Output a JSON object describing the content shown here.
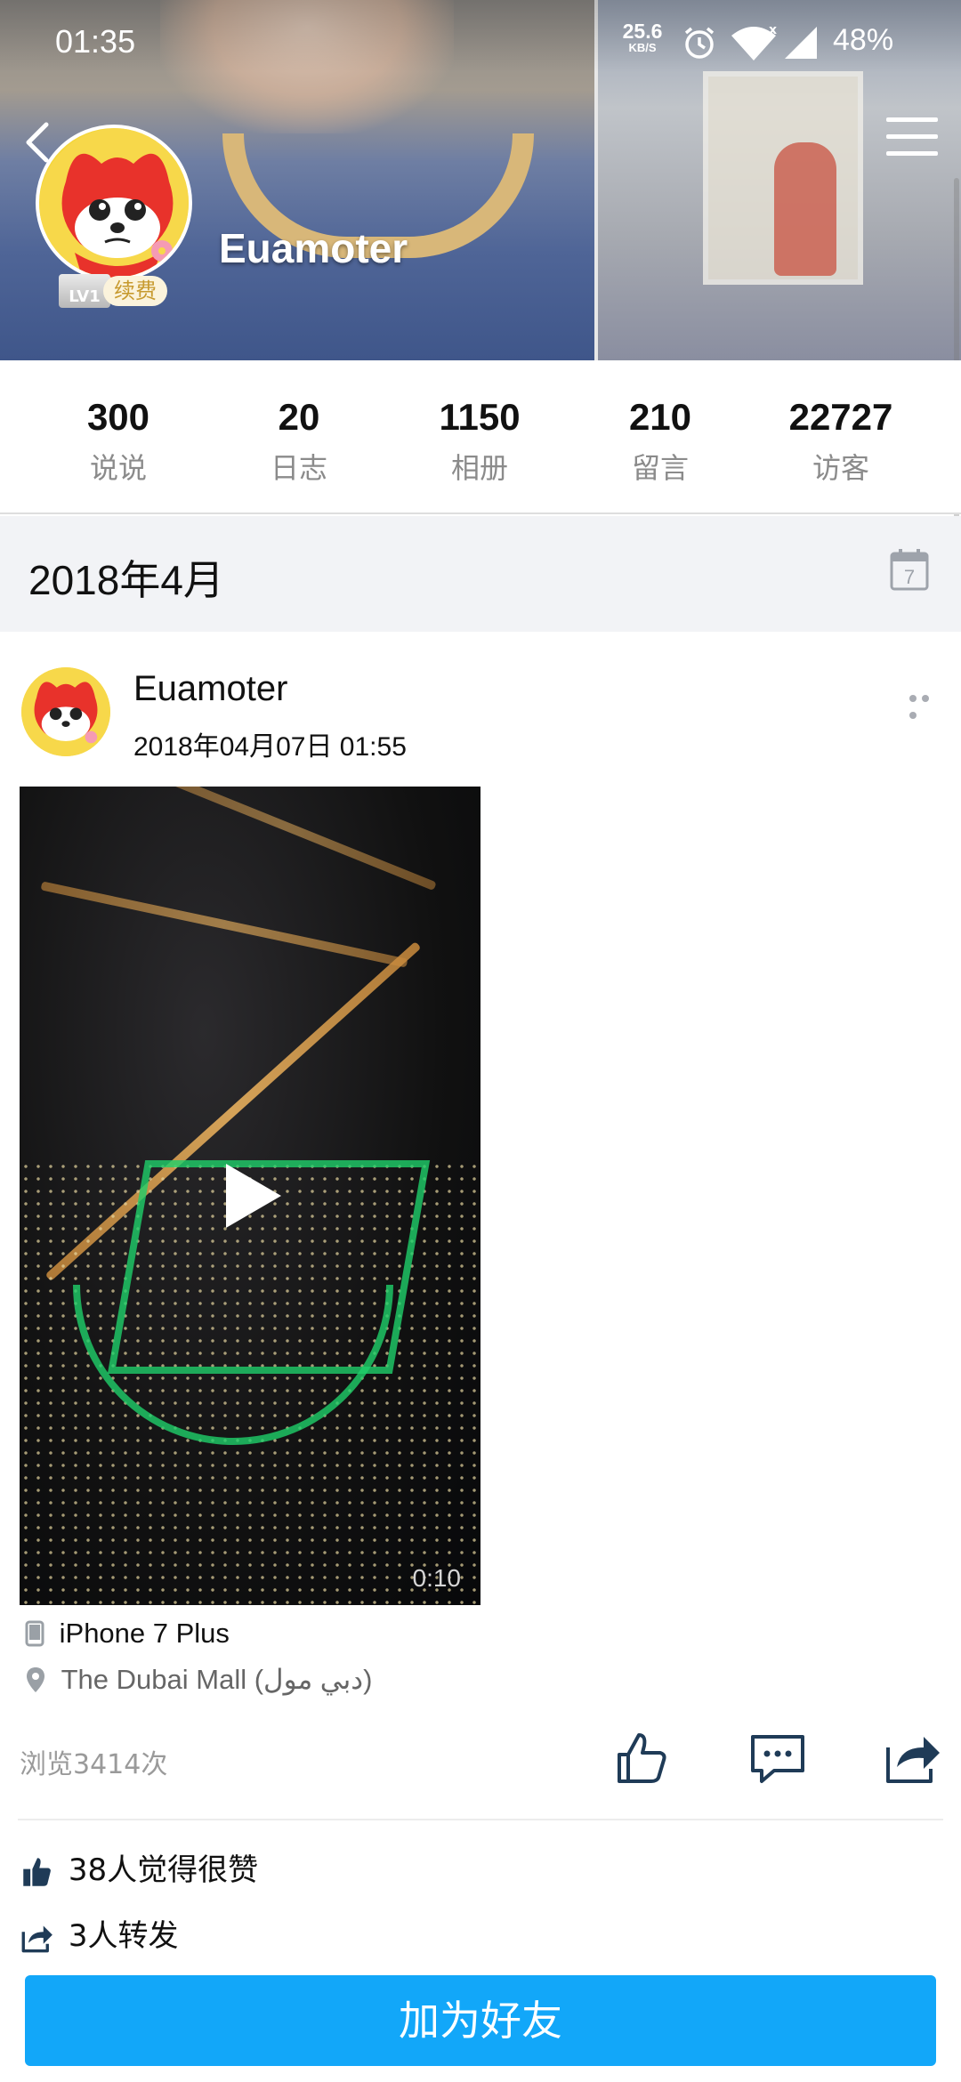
{
  "status_bar": {
    "time": "01:35",
    "net_speed": "25.6",
    "net_unit": "KB/S",
    "battery": "48%",
    "icons": [
      "alarm-icon",
      "wifi-icon",
      "signal-icon"
    ]
  },
  "profile": {
    "name": "Euamoter",
    "level": "LV1",
    "renew_label": "续费"
  },
  "stats": [
    {
      "value": "300",
      "label": "说说"
    },
    {
      "value": "20",
      "label": "日志"
    },
    {
      "value": "1150",
      "label": "相册"
    },
    {
      "value": "210",
      "label": "留言"
    },
    {
      "value": "22727",
      "label": "访客"
    }
  ],
  "month_header": "2018年4月",
  "calendar_icon_day": "7",
  "post": {
    "author": "Euamoter",
    "time": "2018年04月07日 01:55",
    "video_duration": "0:10",
    "device": "iPhone 7 Plus",
    "location": "The Dubai Mall (دبي مول)",
    "views": "浏览3414次",
    "likes": "38人觉得很赞",
    "shares": "3人转发"
  },
  "add_friend_label": "加为好友",
  "colors": {
    "accent_button": "#12a7f9",
    "muted_text": "#8b8b8b",
    "month_bar_bg": "#f2f3f6",
    "icon_dark": "#1f3b57"
  }
}
